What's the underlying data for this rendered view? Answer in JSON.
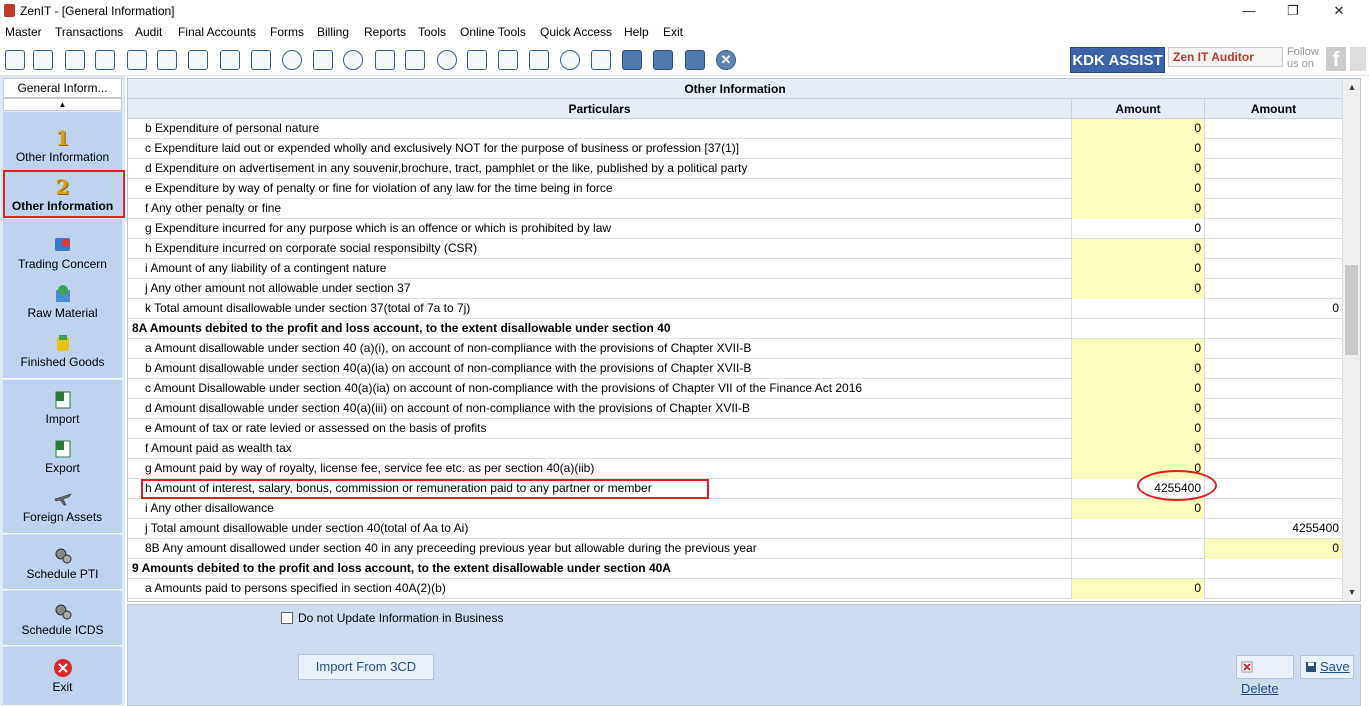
{
  "window": {
    "title": "ZenIT - [General Information]",
    "minimize": "—",
    "restore": "❐",
    "close": "✕"
  },
  "menu": [
    "Master",
    "Transactions",
    "Audit",
    "Final Accounts",
    "Forms",
    "Billing",
    "Reports",
    "Tools",
    "Online Tools",
    "Quick Access",
    "Help",
    "Exit"
  ],
  "toolbar": {
    "kdk_assist": "KDK ASSIST",
    "zen_auditor": "Zen IT Auditor",
    "follow": "Follow us on",
    "fb": "f"
  },
  "sidebar": {
    "header": "General Inform...",
    "scroll_up": "▲",
    "items": [
      {
        "num": "1",
        "label": "Other Information",
        "icon": "number-1-icon"
      },
      {
        "num": "2",
        "label": "Other Information",
        "icon": "number-2-icon"
      },
      {
        "label": "Trading Concern",
        "icon": "trading-concern-icon"
      },
      {
        "label": "Raw Material",
        "icon": "raw-material-icon"
      },
      {
        "label": "Finished Goods",
        "icon": "finished-goods-icon"
      },
      {
        "label": "Import",
        "icon": "excel-import-icon"
      },
      {
        "label": "Export",
        "icon": "excel-export-icon"
      },
      {
        "label": "Foreign Assets",
        "icon": "airplane-icon"
      },
      {
        "label": "Schedule PTI",
        "icon": "gears-icon"
      },
      {
        "label": "Schedule ICDS",
        "icon": "gears-icon"
      },
      {
        "label": "Exit",
        "icon": "exit-icon"
      }
    ]
  },
  "grid": {
    "title": "Other Information",
    "columns": [
      "Particulars",
      "Amount",
      "Amount"
    ],
    "rows": [
      {
        "text": "b Expenditure of personal nature",
        "a1": "0",
        "a2": "",
        "y1": true,
        "y2": false,
        "sec": false
      },
      {
        "text": "c Expenditure laid out or expended wholly and exclusively NOT for the purpose of business or profession [37(1)]",
        "a1": "0",
        "a2": "",
        "y1": true,
        "y2": false,
        "sec": false
      },
      {
        "text": "d Expenditure on advertisement in any souvenir,brochure, tract, pamphlet or the like, published by a political party",
        "a1": "0",
        "a2": "",
        "y1": true,
        "y2": false,
        "sec": false
      },
      {
        "text": "e Expenditure by way of penalty or fine for violation of any law for the time being in force",
        "a1": "0",
        "a2": "",
        "y1": true,
        "y2": false,
        "sec": false
      },
      {
        "text": "f Any other penalty or fine",
        "a1": "0",
        "a2": "",
        "y1": true,
        "y2": false,
        "sec": false
      },
      {
        "text": "g Expenditure incurred for any purpose which is an offence or which is prohibited by law",
        "a1": "0",
        "a2": "",
        "y1": false,
        "y2": false,
        "sec": false
      },
      {
        "text": "h Expenditure incurred on corporate social responsibilty (CSR)",
        "a1": "0",
        "a2": "",
        "y1": true,
        "y2": false,
        "sec": false
      },
      {
        "text": "i Amount of any liability of a contingent nature",
        "a1": "0",
        "a2": "",
        "y1": true,
        "y2": false,
        "sec": false
      },
      {
        "text": "j Any other amount not allowable under section 37",
        "a1": "0",
        "a2": "",
        "y1": true,
        "y2": false,
        "sec": false
      },
      {
        "text": "k Total amount disallowable under section 37(total of 7a to 7j)",
        "a1": "",
        "a2": "0",
        "y1": false,
        "y2": false,
        "sec": false
      },
      {
        "text": "8A Amounts debited to the profit and loss account, to the extent disallowable under section 40",
        "a1": "",
        "a2": "",
        "y1": false,
        "y2": false,
        "sec": true
      },
      {
        "text": "a Amount disallowable under section 40 (a)(i), on account of non-compliance with the provisions of Chapter XVII-B",
        "a1": "0",
        "a2": "",
        "y1": true,
        "y2": false,
        "sec": false
      },
      {
        "text": "b Amount disallowable under section 40(a)(ia) on account of non-compliance with the provisions of Chapter XVII-B",
        "a1": "0",
        "a2": "",
        "y1": true,
        "y2": false,
        "sec": false
      },
      {
        "text": "c Amount Disallowable under section 40(a)(ia) on account of non-compliance with the provisions of Chapter VII of the Finance Act 2016",
        "a1": "0",
        "a2": "",
        "y1": true,
        "y2": false,
        "sec": false
      },
      {
        "text": "d Amount disallowable under section 40(a)(iii) on account of non-compliance with the provisions of Chapter XVII-B",
        "a1": "0",
        "a2": "",
        "y1": true,
        "y2": false,
        "sec": false
      },
      {
        "text": "e Amount of tax or rate levied or assessed on the basis of profits",
        "a1": "0",
        "a2": "",
        "y1": true,
        "y2": false,
        "sec": false
      },
      {
        "text": "f Amount paid as wealth tax",
        "a1": "0",
        "a2": "",
        "y1": true,
        "y2": false,
        "sec": false
      },
      {
        "text": "g Amount paid by way of royalty, license fee, service fee etc. as per section 40(a)(iib)",
        "a1": "0",
        "a2": "",
        "y1": true,
        "y2": false,
        "sec": false
      },
      {
        "text": "h Amount of interest, salary, bonus, commission or remuneration paid to any partner or member",
        "a1": "4255400",
        "a2": "",
        "y1": false,
        "y2": false,
        "sec": false
      },
      {
        "text": "i Any other disallowance",
        "a1": "0",
        "a2": "",
        "y1": true,
        "y2": false,
        "sec": false
      },
      {
        "text": "j Total amount disallowable under section 40(total of Aa to Ai)",
        "a1": "",
        "a2": "4255400",
        "y1": false,
        "y2": false,
        "sec": false
      },
      {
        "text": "8B Any amount disallowed under section 40 in any preceeding previous year but allowable during the previous year",
        "a1": "",
        "a2": "0",
        "y1": false,
        "y2": true,
        "sec": false
      },
      {
        "text": "9 Amounts debited to the profit and loss account, to the extent disallowable under section 40A",
        "a1": "",
        "a2": "",
        "y1": false,
        "y2": false,
        "sec": true
      },
      {
        "text": "a Amounts paid to persons specified in section 40A(2)(b)",
        "a1": "0",
        "a2": "",
        "y1": true,
        "y2": false,
        "sec": false
      }
    ]
  },
  "bottom": {
    "checkbox_label": "Do not Update Information in Business",
    "import_btn": "Import From 3CD",
    "delete_btn": "Delete",
    "save_btn": "Save"
  },
  "colors": {
    "highlight": "#e02020",
    "yellow_cell": "#fcfcbe",
    "accent": "#3a64a7"
  }
}
